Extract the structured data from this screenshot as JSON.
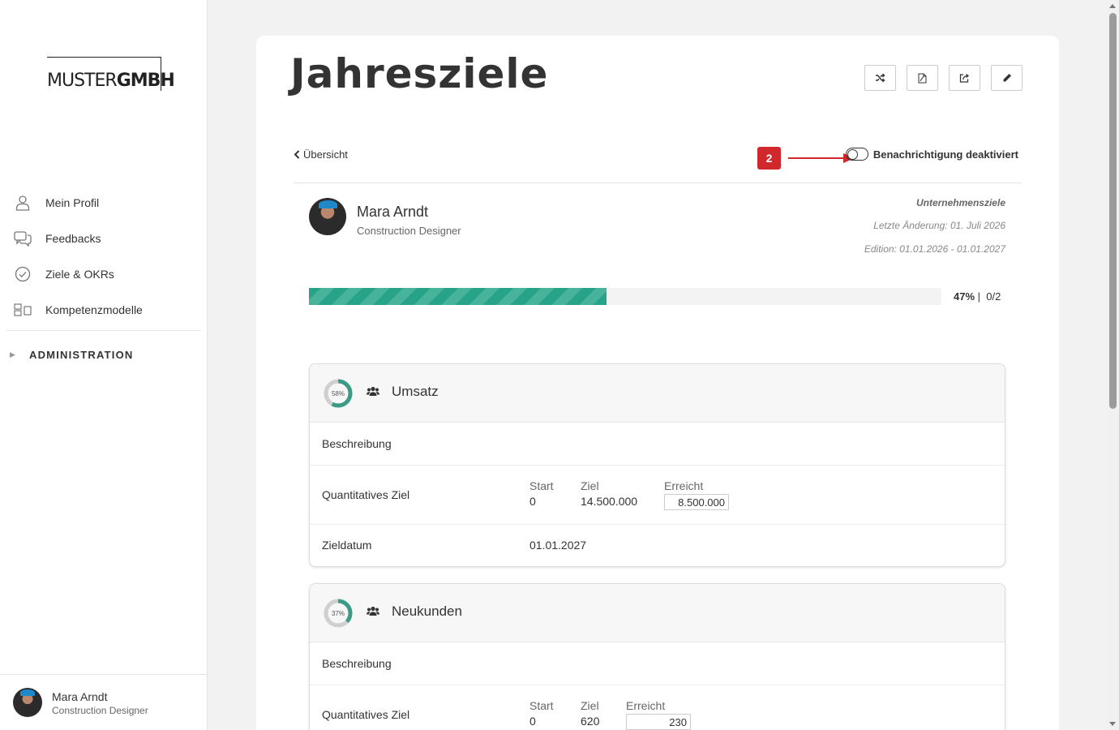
{
  "brand": {
    "logo_light": "MUSTER",
    "logo_bold": "GMBH"
  },
  "sidebar": {
    "items": [
      {
        "label": "Mein Profil",
        "icon": "user-icon"
      },
      {
        "label": "Feedbacks",
        "icon": "chat-icon"
      },
      {
        "label": "Ziele & OKRs",
        "icon": "check-circle-icon"
      },
      {
        "label": "Kompetenzmodelle",
        "icon": "grid-icon"
      }
    ],
    "admin_label": "ADMINISTRATION",
    "user": {
      "name": "Mara Arndt",
      "role": "Construction Designer"
    }
  },
  "page": {
    "title": "Jahresziele",
    "back_label": "Übersicht",
    "notification_label": "Benachrichtigung deaktiviert",
    "marker": "2",
    "toolbar": [
      "shuffle-icon",
      "pdf-icon",
      "share-icon",
      "pencil-icon"
    ]
  },
  "person": {
    "name": "Mara Arndt",
    "role": "Construction Designer",
    "category": "Unternehmensziele",
    "last_change": "Letzte Änderung: 01. Juli 2026",
    "edition": "Edition: 01.01.2026 - 01.01.2027"
  },
  "progress": {
    "percent": 47,
    "percent_label": "47%",
    "count": "0/2"
  },
  "goals": [
    {
      "title": "Umsatz",
      "percent": 58,
      "percent_label": "58%",
      "description_label": "Beschreibung",
      "quant_label": "Quantitatives Ziel",
      "start_label": "Start",
      "start": "0",
      "target_label": "Ziel",
      "target": "14.500.000",
      "reached_label": "Erreicht",
      "reached": "8.500.000",
      "date_label": "Zieldatum",
      "date": "01.01.2027"
    },
    {
      "title": "Neukunden",
      "percent": 37,
      "percent_label": "37%",
      "description_label": "Beschreibung",
      "quant_label": "Quantitatives Ziel",
      "start_label": "Start",
      "start": "0",
      "target_label": "Ziel",
      "target": "620",
      "reached_label": "Erreicht",
      "reached": "230"
    }
  ],
  "colors": {
    "accent": "#27a389",
    "marker": "#d0282d"
  }
}
